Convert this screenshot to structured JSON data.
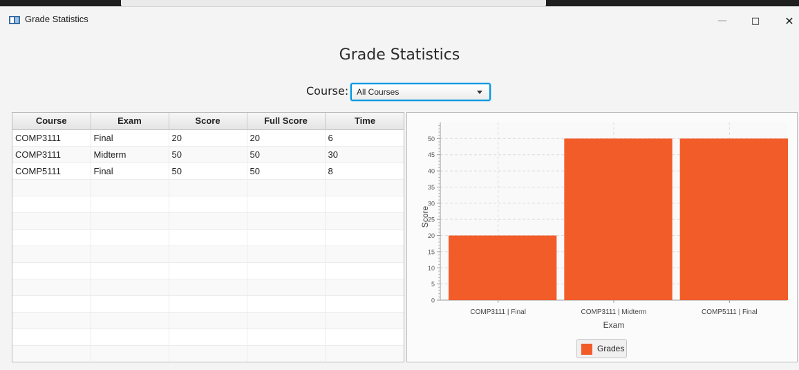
{
  "window": {
    "title": "Grade Statistics",
    "icons": [
      "app-icon",
      "minimize-icon",
      "maximize-icon",
      "close-icon"
    ]
  },
  "page": {
    "heading": "Grade Statistics",
    "course_label": "Course:",
    "course_selected": "All Courses"
  },
  "table": {
    "columns": [
      "Course",
      "Exam",
      "Score",
      "Full Score",
      "Time"
    ],
    "rows": [
      [
        "COMP3111",
        "Final",
        "20",
        "20",
        "6"
      ],
      [
        "COMP3111",
        "Midterm",
        "50",
        "50",
        "30"
      ],
      [
        "COMP5111",
        "Final",
        "50",
        "50",
        "8"
      ]
    ]
  },
  "colors": {
    "accent": "#0096e0",
    "bar": "#f25c29"
  },
  "chart_data": {
    "type": "bar",
    "categories": [
      "COMP3111 | Final",
      "COMP3111 | Midterm",
      "COMP5111 | Final"
    ],
    "series": [
      {
        "name": "Grades",
        "values": [
          20,
          50,
          50
        ]
      }
    ],
    "xlabel": "Exam",
    "ylabel": "Score",
    "ylim": [
      0,
      55
    ],
    "yticks": [
      0,
      5,
      10,
      15,
      20,
      25,
      30,
      35,
      40,
      45,
      50
    ],
    "legend": "bottom",
    "grid": true
  }
}
